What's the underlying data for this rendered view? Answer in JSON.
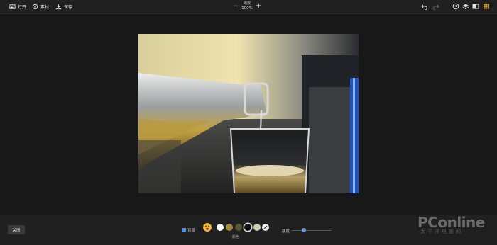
{
  "toolbar": {
    "open_label": "打开",
    "material_label": "素材",
    "save_label": "保存"
  },
  "zoom": {
    "label": "缩放",
    "value": "100%",
    "minus": "−",
    "plus": "+"
  },
  "right_icons": [
    "undo-icon",
    "redo-icon",
    "history-icon",
    "layers-icon",
    "compare-icon",
    "grid-icon"
  ],
  "bottom": {
    "close_label": "关闭",
    "background_label": "背景",
    "color_label": "颜色",
    "strength_label": "强度",
    "strength_value": 0.3,
    "swatches": [
      {
        "name": "swatch-white",
        "color": "#ffffff"
      },
      {
        "name": "swatch-olive",
        "color": "#a08a3c"
      },
      {
        "name": "swatch-dark-olive",
        "color": "#5a5438"
      },
      {
        "name": "swatch-black",
        "color": "#111111"
      },
      {
        "name": "swatch-pale-sage",
        "color": "#c9cfb0"
      }
    ],
    "selected_swatch": "swatch-black"
  },
  "watermark": {
    "main": "PConline",
    "sub": "太平洋电脑网"
  },
  "colors": {
    "accent": "#5a8fd6"
  }
}
